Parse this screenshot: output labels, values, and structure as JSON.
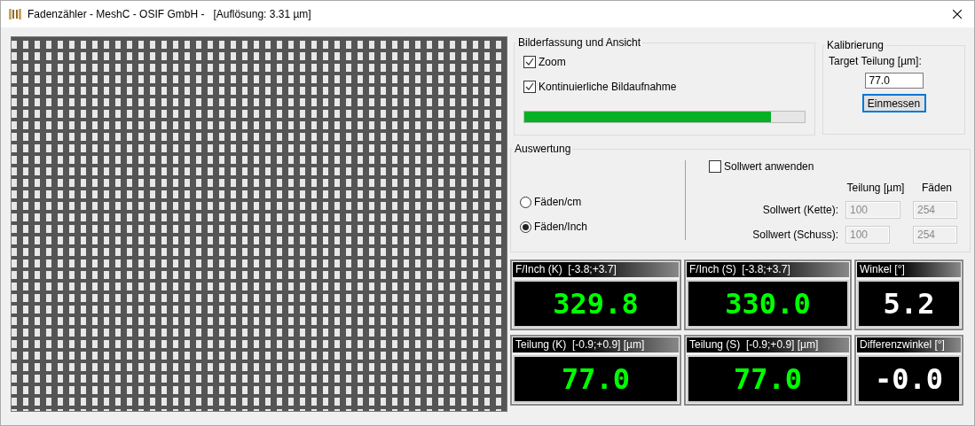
{
  "window": {
    "title": "Fadenzähler - MeshC - OSIF GmbH -   [Auflösung: 3.31 µm]"
  },
  "acquisition": {
    "title": "Bilderfassung und Ansicht",
    "options": [
      {
        "label": "Zoom",
        "checked": true
      },
      {
        "label": "Kontinuierliche Bildaufnahme",
        "checked": true
      }
    ],
    "progress": {
      "level": 0.88
    }
  },
  "calibration": {
    "title": "Kalibrierung",
    "label": "Target Teilung [µm]:",
    "value": "77.0",
    "button": "Einmessen"
  },
  "evaluation": {
    "title": "Auswertung",
    "units": [
      {
        "label": "Fäden/cm",
        "selected": false
      },
      {
        "label": "Fäden/Inch",
        "selected": true
      }
    ],
    "apply_setpoint": {
      "label": "Sollwert anwenden",
      "checked": false
    },
    "columns": [
      "Teilung [µm]",
      "Fäden"
    ],
    "rows": [
      {
        "label": "Sollwert (Kette):",
        "values": [
          "100",
          "254"
        ],
        "disabled": true
      },
      {
        "label": "Sollwert (Schuss):",
        "values": [
          "100",
          "254"
        ],
        "disabled": true
      }
    ]
  },
  "displays": [
    {
      "title": "F/Inch (K)  [-3.8;+3.7]",
      "value": "329.8",
      "color": "#00ff00"
    },
    {
      "title": "F/Inch (S)  [-3.8;+3.7]",
      "value": "330.0",
      "color": "#00ff00"
    },
    {
      "title": "Winkel [°]",
      "value": "5.2",
      "color": "#ffffff"
    },
    {
      "title": "Teilung (K)  [-0.9;+0.9] [µm]",
      "value": "77.0",
      "color": "#00ff00"
    },
    {
      "title": "Teilung (S)  [-0.9;+0.9] [µm]",
      "value": "77.0",
      "color": "#00ff00"
    },
    {
      "title": "Differenzwinkel [°]",
      "value": "-0.0",
      "color": "#ffffff"
    }
  ]
}
